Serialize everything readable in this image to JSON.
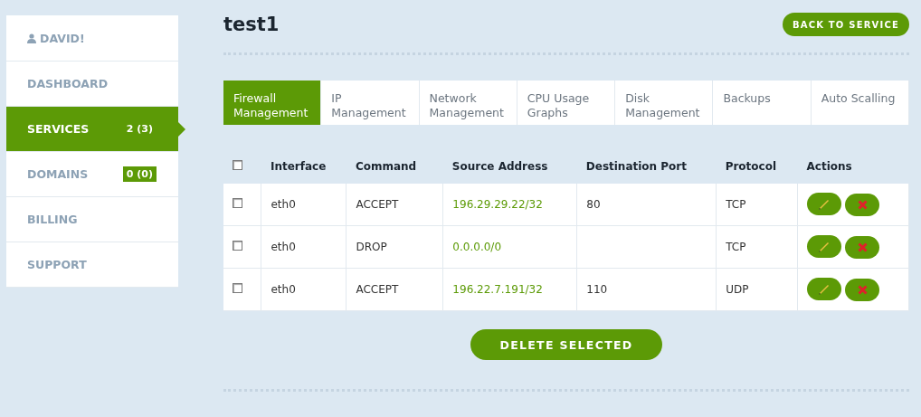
{
  "sidebar": {
    "user": "DAVID!",
    "items": [
      {
        "label": "DASHBOARD",
        "selected": false
      },
      {
        "label": "SERVICES",
        "badge": "2 (3)",
        "selected": true
      },
      {
        "label": "DOMAINS",
        "badge": "0 (0)",
        "selected": false
      },
      {
        "label": "BILLING",
        "selected": false
      },
      {
        "label": "SUPPORT",
        "selected": false
      }
    ]
  },
  "page": {
    "title": "test1",
    "back_button": "BACK TO SERVICE"
  },
  "tabs": [
    {
      "label": "Firewall Management",
      "selected": true
    },
    {
      "label": "IP Management",
      "selected": false
    },
    {
      "label": "Network Management",
      "selected": false
    },
    {
      "label": "CPU Usage Graphs",
      "selected": false
    },
    {
      "label": "Disk Management",
      "selected": false
    },
    {
      "label": "Backups",
      "selected": false
    },
    {
      "label": "Auto Scalling",
      "selected": false
    }
  ],
  "table": {
    "select_all_checked": false,
    "columns": [
      "Interface",
      "Command",
      "Source Address",
      "Destination Port",
      "Protocol",
      "Actions"
    ],
    "rows": [
      {
        "checked": false,
        "interface": "eth0",
        "command": "ACCEPT",
        "source": "196.29.29.22/32",
        "port": "80",
        "protocol": "TCP"
      },
      {
        "checked": false,
        "interface": "eth0",
        "command": "DROP",
        "source": "0.0.0.0/0",
        "port": "",
        "protocol": "TCP"
      },
      {
        "checked": false,
        "interface": "eth0",
        "command": "ACCEPT",
        "source": "196.22.7.191/32",
        "port": "110",
        "protocol": "UDP"
      }
    ]
  },
  "delete_button": "DELETE SELECTED"
}
